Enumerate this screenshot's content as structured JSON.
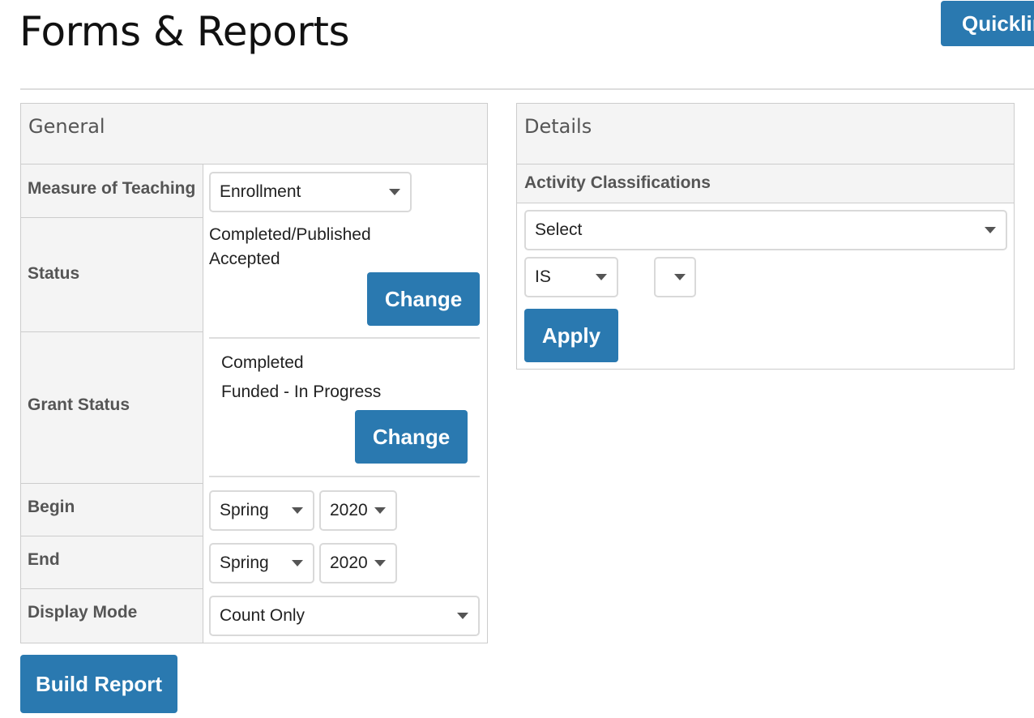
{
  "page": {
    "title": "Forms & Reports",
    "quicklinks_label": "Quicklinks"
  },
  "general": {
    "heading": "General",
    "labels": {
      "measure_of_teaching": "Measure of Teaching",
      "status": "Status",
      "grant_status": "Grant Status",
      "begin": "Begin",
      "end": "End",
      "display_mode": "Display Mode"
    },
    "measure_of_teaching_value": "Enrollment",
    "status_values": [
      "Completed/Published",
      "Accepted"
    ],
    "status_change_label": "Change",
    "grant_status_values": [
      "Completed",
      "Funded - In Progress"
    ],
    "grant_status_change_label": "Change",
    "begin_term": "Spring",
    "begin_year": "2020",
    "end_term": "Spring",
    "end_year": "2020",
    "display_mode_value": "Count Only"
  },
  "details": {
    "heading": "Details",
    "subheading": "Activity Classifications",
    "classification_select": "Select",
    "operator_select": "IS",
    "value_select": "",
    "apply_label": "Apply"
  },
  "actions": {
    "build_report_label": "Build Report"
  },
  "colors": {
    "primary_button": "#2a79b0",
    "panel_header_bg": "#f4f4f4",
    "border": "#cccccc"
  },
  "icons": {
    "dropdown": "chevron-down-icon"
  }
}
